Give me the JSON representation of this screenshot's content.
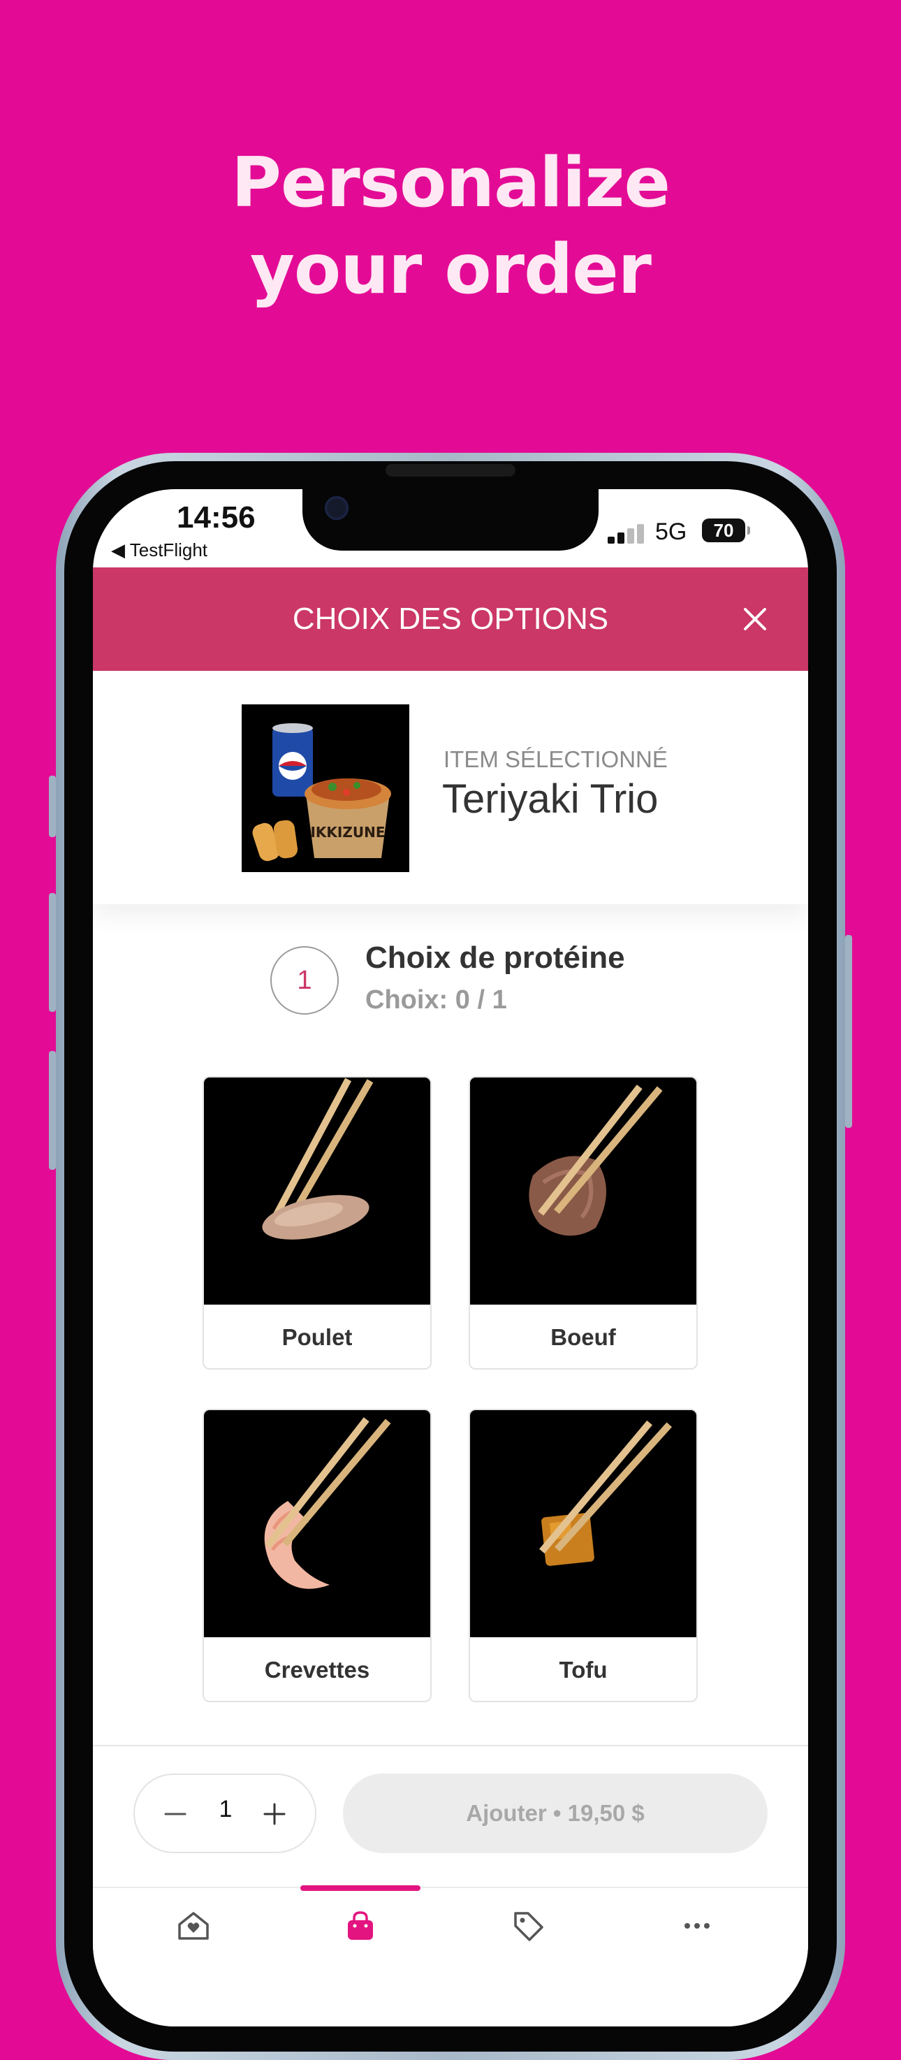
{
  "promo": {
    "headline_line1": "Personalize",
    "headline_line2": "your order"
  },
  "status_bar": {
    "time": "14:56",
    "back_app": "◀ TestFlight",
    "network": "5G",
    "battery": "70"
  },
  "modal": {
    "title": "CHOIX DES OPTIONS"
  },
  "selected_item": {
    "caption": "ITEM SÉLECTIONNÉ",
    "name": "Teriyaki Trio"
  },
  "option_group": {
    "number": "1",
    "title": "Choix de protéine",
    "selection_count": "Choix: 0 / 1"
  },
  "options": [
    {
      "label": "Poulet"
    },
    {
      "label": "Boeuf"
    },
    {
      "label": "Crevettes"
    },
    {
      "label": "Tofu"
    }
  ],
  "footer": {
    "quantity": "1",
    "add_button": "Ajouter • 19,50 $"
  },
  "tabbar": {
    "active_index": 1,
    "icons": [
      "home-heart-icon",
      "shopping-bag-icon",
      "tag-icon",
      "more-icon"
    ]
  },
  "colors": {
    "background": "#e30b95",
    "header": "#cb3766",
    "accent": "#e3147f"
  }
}
